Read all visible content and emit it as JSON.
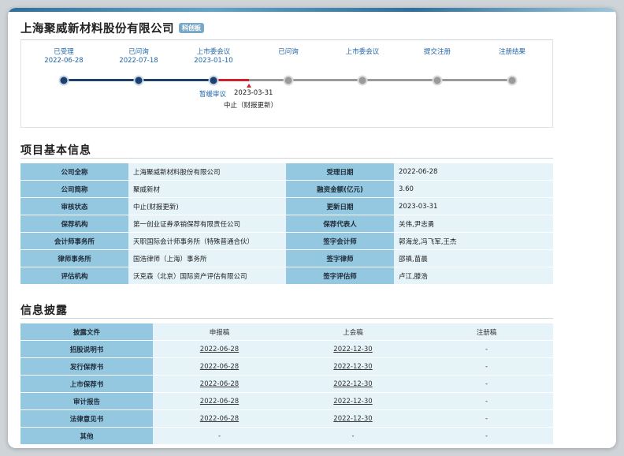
{
  "company": {
    "name": "上海聚威新材料股份有限公司",
    "board_badge": "科创板"
  },
  "timeline": {
    "stages": [
      {
        "label": "已受理",
        "date": "2022-06-28",
        "status": "done"
      },
      {
        "label": "已问询",
        "date": "2022-07-18",
        "status": "done"
      },
      {
        "label": "上市委会议",
        "date": "2023-01-10",
        "status": "done"
      },
      {
        "label": "已问询",
        "date": "",
        "status": "todo"
      },
      {
        "label": "上市委会议",
        "date": "",
        "status": "todo"
      },
      {
        "label": "提交注册",
        "date": "",
        "status": "todo"
      },
      {
        "label": "注册结果",
        "date": "",
        "status": "todo"
      }
    ],
    "suspend_label": "暂缓审议",
    "stop_date": "2023-03-31",
    "stop_label": "中止（财报更新）",
    "colors": {
      "done": "#1d3f6e",
      "stopped": "#d0202a",
      "todo": "#9a9a9a"
    }
  },
  "basic_info": {
    "title": "项目基本信息",
    "rows": [
      {
        "l1": "公司全称",
        "v1": "上海聚威新材料股份有限公司",
        "l2": "受理日期",
        "v2": "2022-06-28"
      },
      {
        "l1": "公司简称",
        "v1": "聚威新材",
        "l2": "融资金额(亿元)",
        "v2": "3.60"
      },
      {
        "l1": "审核状态",
        "v1": "中止(财报更新)",
        "l2": "更新日期",
        "v2": "2023-03-31"
      },
      {
        "l1": "保荐机构",
        "v1": "第一创业证券承销保荐有限责任公司",
        "l2": "保荐代表人",
        "v2": "关伟,尹志勇"
      },
      {
        "l1": "会计师事务所",
        "v1": "天职国际会计师事务所（特殊普通合伙）",
        "l2": "签字会计师",
        "v2": "郭海龙,冯飞军,王杰"
      },
      {
        "l1": "律师事务所",
        "v1": "国浩律师（上海）事务所",
        "l2": "签字律师",
        "v2": "邵禛,苗晨"
      },
      {
        "l1": "评估机构",
        "v1": "沃克森（北京）国际资产评估有限公司",
        "l2": "签字评估师",
        "v2": "卢江,滕浩"
      }
    ]
  },
  "disclosure": {
    "title": "信息披露",
    "headers": [
      "披露文件",
      "申报稿",
      "上会稿",
      "注册稿"
    ],
    "rows": [
      {
        "doc": "招股说明书",
        "c1": "2022-06-28",
        "c2": "2022-12-30",
        "c3": "-"
      },
      {
        "doc": "发行保荐书",
        "c1": "2022-06-28",
        "c2": "2022-12-30",
        "c3": "-"
      },
      {
        "doc": "上市保荐书",
        "c1": "2022-06-28",
        "c2": "2022-12-30",
        "c3": "-"
      },
      {
        "doc": "审计报告",
        "c1": "2022-06-28",
        "c2": "2022-12-30",
        "c3": "-"
      },
      {
        "doc": "法律意见书",
        "c1": "2022-06-28",
        "c2": "2022-12-30",
        "c3": "-"
      },
      {
        "doc": "其他",
        "c1": "-",
        "c2": "-",
        "c3": "-"
      }
    ]
  }
}
